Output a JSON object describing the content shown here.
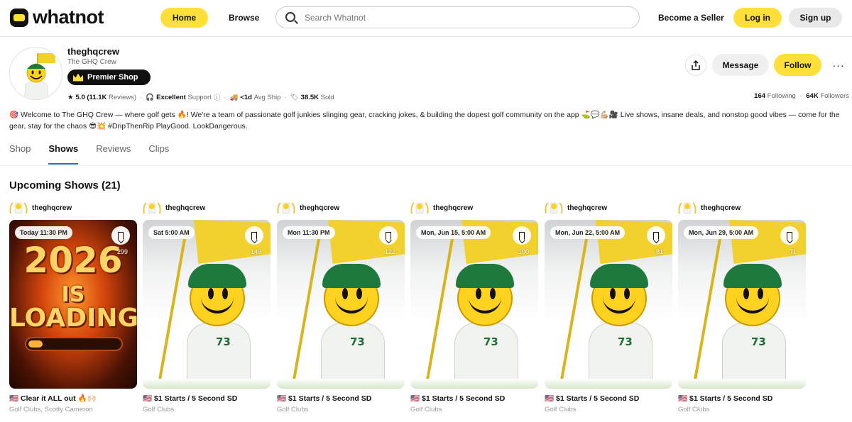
{
  "header": {
    "logo_text": "whatnot",
    "home_label": "Home",
    "browse_label": "Browse",
    "search_placeholder": "Search Whatnot",
    "become_seller_label": "Become a Seller",
    "login_label": "Log in",
    "signup_label": "Sign up"
  },
  "profile": {
    "username": "theghqcrew",
    "display_name": "The GHQ Crew",
    "badge": "Premier Shop",
    "rating": "5.0",
    "reviews_count": "(11.1K",
    "reviews_label": "Reviews)",
    "support_value": "Excellent",
    "support_label": "Support",
    "ship_value": "<1d",
    "ship_label": "Avg Ship",
    "sold_value": "38.5K",
    "sold_label": "Sold",
    "following_count": "164",
    "following_label": "Following",
    "followers_count": "64K",
    "followers_label": "Followers",
    "message_label": "Message",
    "follow_label": "Follow",
    "bio": "🎯 Welcome to The GHQ Crew — where golf gets 🔥! We're a team of passionate golf junkies slinging gear, cracking jokes, & building the dopest golf community on the app ⛳💬💪🏼🎥 Live shows, insane deals, and nonstop good vibes — come for the gear, stay for the chaos 😎💥 #DripThenRip PlayGood. LookDangerous."
  },
  "tabs": [
    {
      "label": "Shop",
      "active": false
    },
    {
      "label": "Shows",
      "active": true
    },
    {
      "label": "Reviews",
      "active": false
    },
    {
      "label": "Clips",
      "active": false
    }
  ],
  "section": {
    "title": "Upcoming Shows (21)"
  },
  "shows": [
    {
      "host": "theghqcrew",
      "time": "Today 11:30 PM",
      "count": "299",
      "title": "🇺🇸 Clear it ALL out 🔥🙌🏻",
      "category": "Golf Clubs, Scotty Cameron",
      "art": "fire",
      "art_top": "2026",
      "art_mid": "IS",
      "art_bottom": "LOADING"
    },
    {
      "host": "theghqcrew",
      "time": "Sat 5:00 AM",
      "count": "149",
      "title": "🇺🇸 $1 Starts / 5 Second SD",
      "category": "Golf Clubs",
      "art": "golfer"
    },
    {
      "host": "theghqcrew",
      "time": "Mon 11:30 PM",
      "count": "122",
      "title": "🇺🇸 $1 Starts / 5 Second SD",
      "category": "Golf Clubs",
      "art": "golfer"
    },
    {
      "host": "theghqcrew",
      "time": "Mon, Jun 15, 5:00 AM",
      "count": "100",
      "title": "🇺🇸 $1 Starts / 5 Second SD",
      "category": "Golf Clubs",
      "art": "golfer"
    },
    {
      "host": "theghqcrew",
      "time": "Mon, Jun 22, 5:00 AM",
      "count": "81",
      "title": "🇺🇸 $1 Starts / 5 Second SD",
      "category": "Golf Clubs",
      "art": "golfer"
    },
    {
      "host": "theghqcrew",
      "time": "Mon, Jun 29, 5:00 AM",
      "count": "71",
      "title": "🇺🇸 $1 Starts / 5 Second SD",
      "category": "Golf Clubs",
      "art": "golfer"
    }
  ],
  "colors": {
    "brand_yellow": "#ffe03b",
    "tab_underline": "#2f6fbd"
  }
}
